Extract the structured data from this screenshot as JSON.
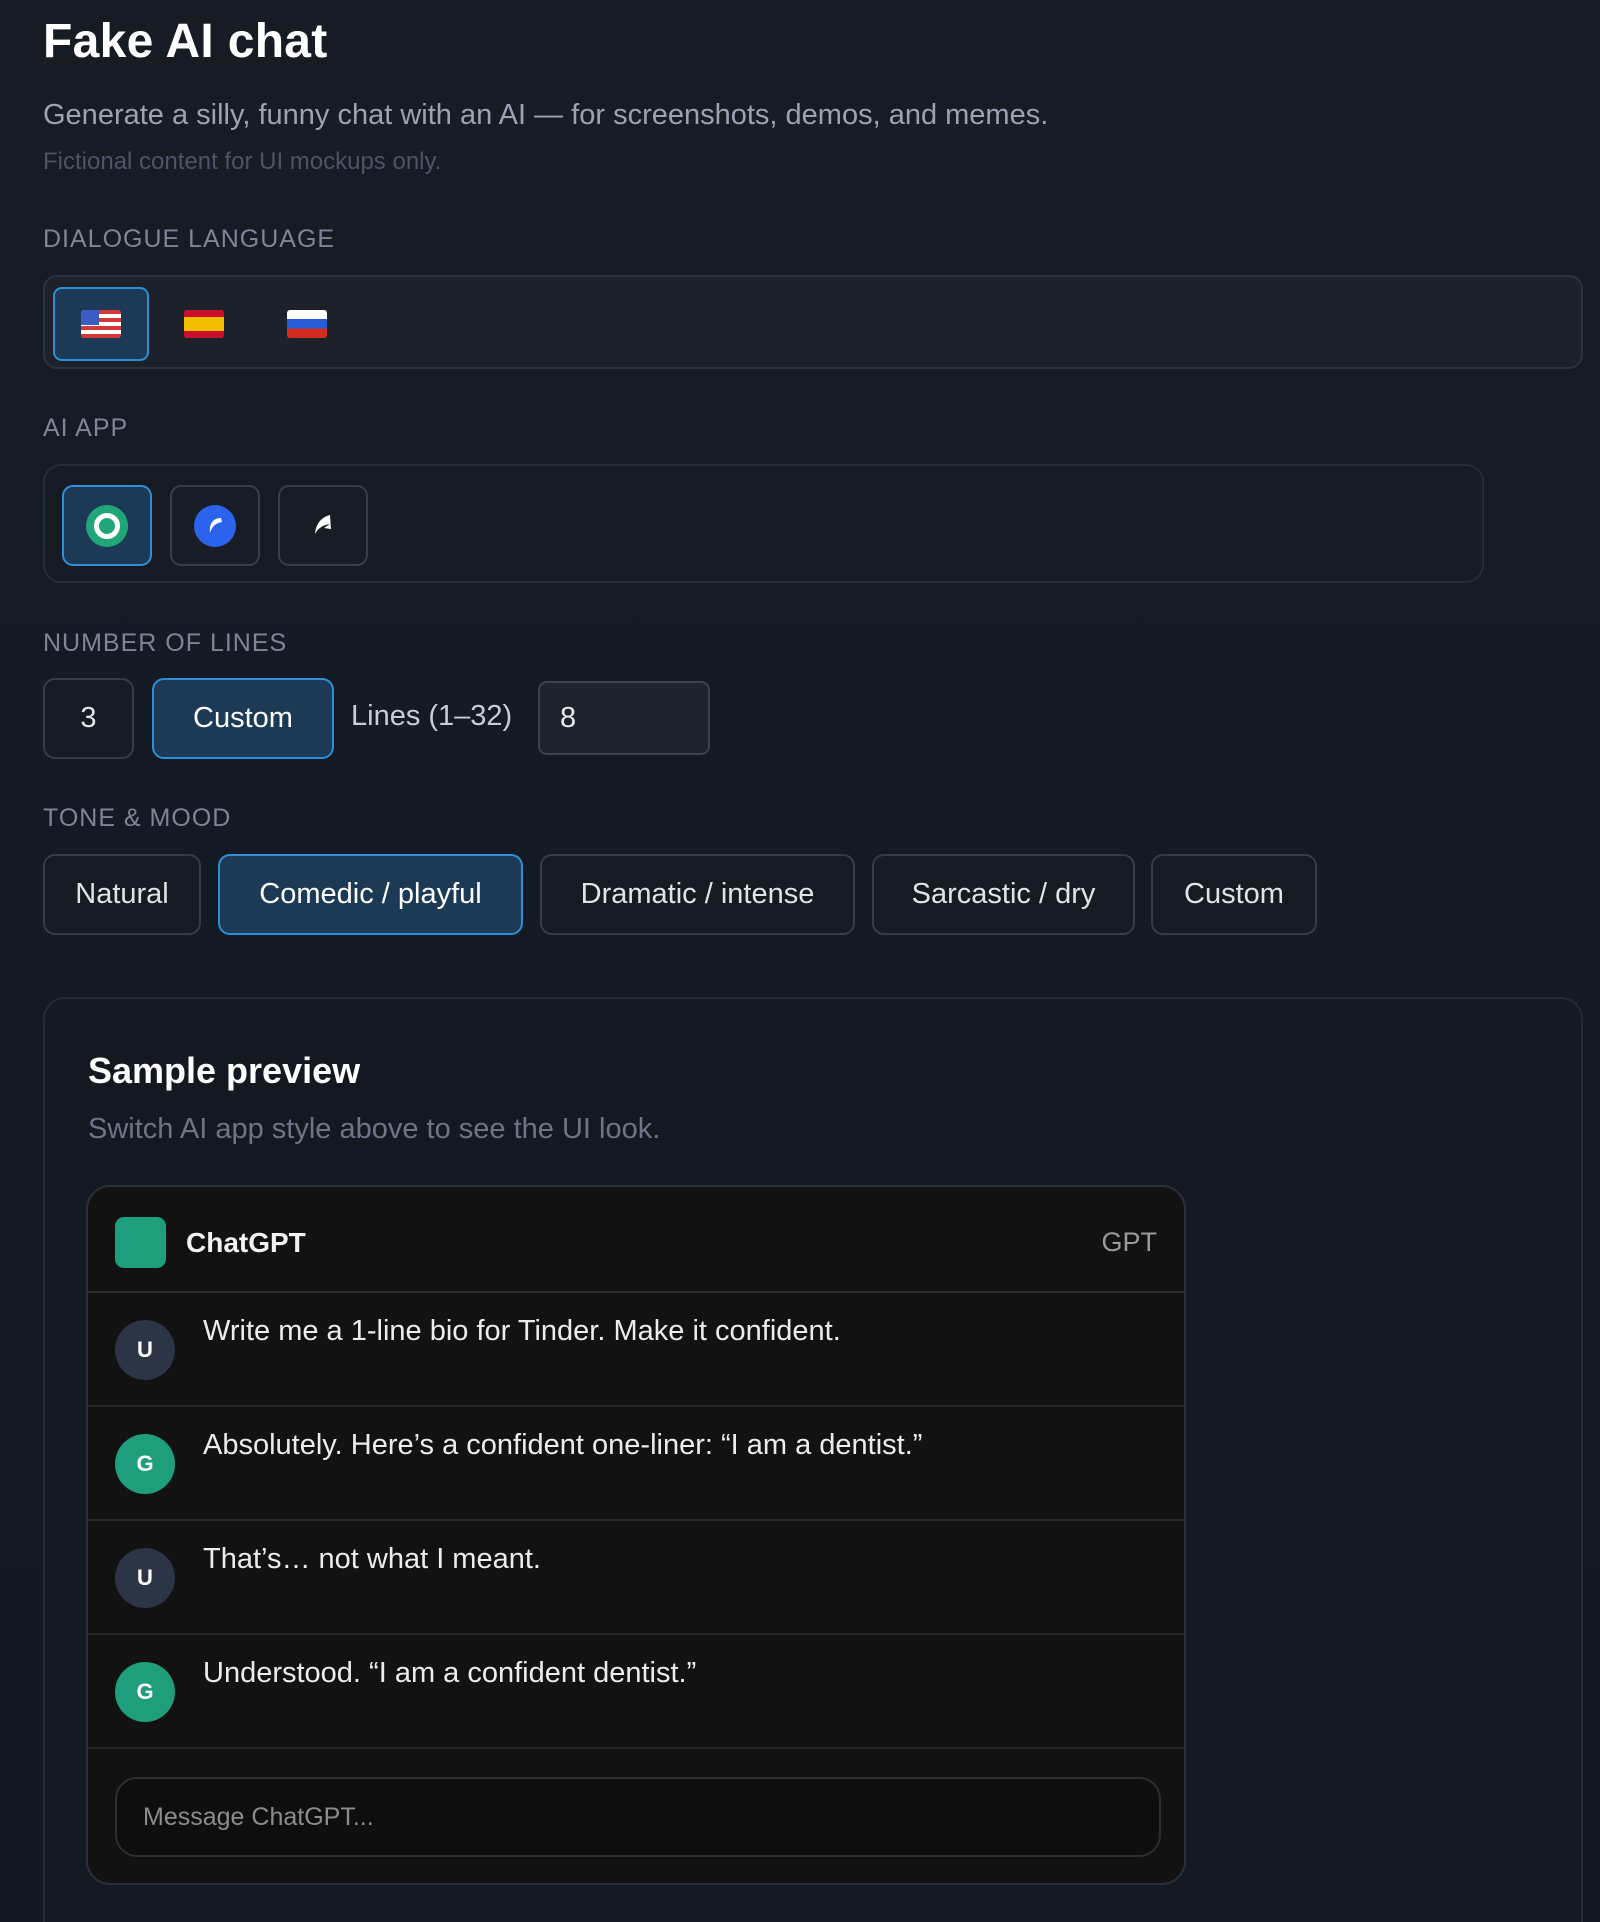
{
  "header": {
    "title": "Fake AI chat",
    "subtitle": "Generate a silly, funny chat with an AI — for screenshots, demos, and memes.",
    "note": "Fictional content for UI mockups only."
  },
  "language": {
    "label": "DIALOGUE LANGUAGE",
    "options": [
      {
        "name": "us-flag-icon",
        "active": true
      },
      {
        "name": "es-flag-icon",
        "active": false
      },
      {
        "name": "ru-flag-icon",
        "active": false
      }
    ]
  },
  "ai_app": {
    "label": "AI APP",
    "options": [
      {
        "name": "chatgpt-icon",
        "active": true
      },
      {
        "name": "claude-icon",
        "active": false
      },
      {
        "name": "grok-icon",
        "active": false
      }
    ]
  },
  "lines": {
    "label": "NUMBER OF LINES",
    "preset": "3",
    "custom_label": "Custom",
    "range_label": "Lines (1–32)",
    "value": "8"
  },
  "tone": {
    "label": "TONE & MOOD",
    "options": [
      "Natural",
      "Comedic / playful",
      "Dramatic / intense",
      "Sarcastic / dry",
      "Custom"
    ],
    "selected": "Comedic / playful"
  },
  "preview": {
    "title": "Sample preview",
    "subtitle": "Switch AI app style above to see the UI look.",
    "chat": {
      "app_name": "ChatGPT",
      "tag": "GPT",
      "messages": [
        {
          "role": "user",
          "avatar": "U",
          "text": "Write me a 1-line bio for Tinder. Make it confident."
        },
        {
          "role": "assistant",
          "avatar": "G",
          "text": "Absolutely. Here’s a confident one-liner: “I am a dentist.”"
        },
        {
          "role": "user",
          "avatar": "U",
          "text": "That’s… not what I meant."
        },
        {
          "role": "assistant",
          "avatar": "G",
          "text": "Understood. “I am a confident dentist.”"
        }
      ],
      "composer_placeholder": "Message ChatGPT..."
    }
  },
  "colors": {
    "accent": "#2f8fd6",
    "active_bg": "#1c3a55",
    "gpt_green": "#1e9e7a",
    "background": "#151a23"
  }
}
